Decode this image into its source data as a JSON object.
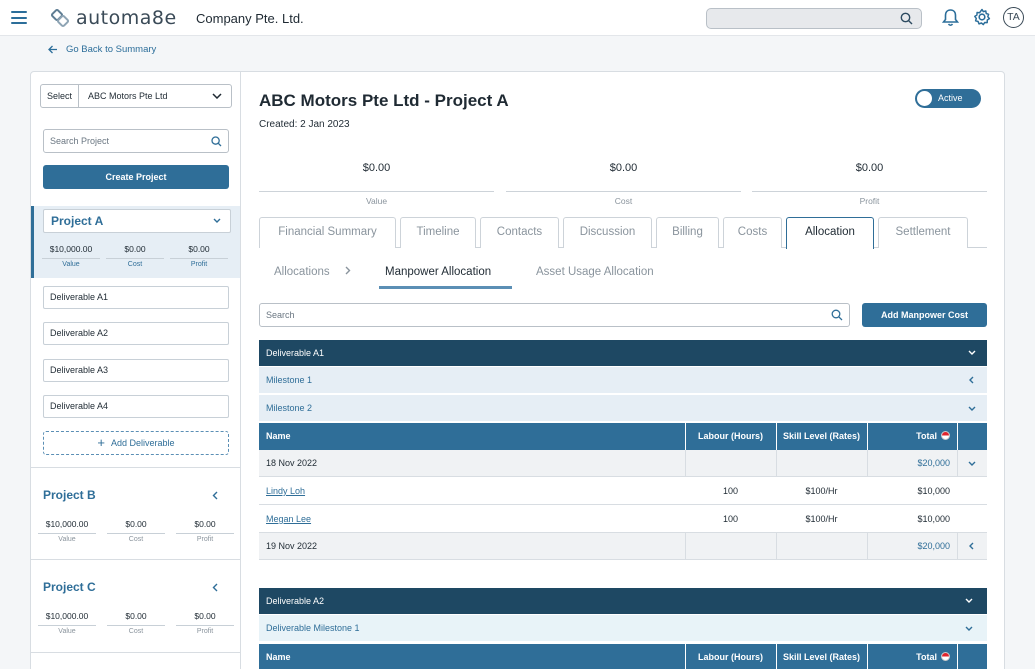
{
  "header": {
    "brand": "automa8e",
    "company": "Company Pte. Ltd.",
    "avatar_initials": "TA",
    "search_placeholder": ""
  },
  "back_link": "Go Back to Summary",
  "sidebar": {
    "select_label": "Select",
    "selected_client": "ABC Motors Pte Ltd",
    "search_placeholder": "Search Project",
    "create_label": "Create Project",
    "add_deliverable_label": "Add Deliverable",
    "projects": [
      {
        "name": "Project A",
        "value": "$10,000.00",
        "cost": "$0.00",
        "profit": "$0.00"
      },
      {
        "name": "Project B",
        "value": "$10,000.00",
        "cost": "$0.00",
        "profit": "$0.00"
      },
      {
        "name": "Project C",
        "value": "$10,000.00",
        "cost": "$0.00",
        "profit": "$0.00"
      }
    ],
    "stat_labels": {
      "value": "Value",
      "cost": "Cost",
      "profit": "Profit"
    },
    "deliverables": [
      "Deliverable A1",
      "Deliverable A2",
      "Deliverable A3",
      "Deliverable A4"
    ]
  },
  "main": {
    "title": "ABC Motors Pte Ltd - Project A",
    "created": "Created: 2 Jan 2023",
    "status": "Active",
    "summary": [
      {
        "amount": "$0.00",
        "label": "Value"
      },
      {
        "amount": "$0.00",
        "label": "Cost"
      },
      {
        "amount": "$0.00",
        "label": "Profit"
      }
    ],
    "tabs": [
      "Financial Summary",
      "Timeline",
      "Contacts",
      "Discussion",
      "Billing",
      "Costs",
      "Allocation",
      "Settlement"
    ],
    "active_tab": "Allocation",
    "subtabs": [
      "Allocations",
      "Manpower Allocation",
      "Asset Usage Allocation"
    ],
    "search_placeholder": "Search",
    "add_cost_label": "Add Manpower Cost"
  },
  "table": {
    "columns": [
      "Name",
      "Labour (Hours)",
      "Skill Level (Rates)",
      "Total"
    ],
    "sections": [
      {
        "deliverable": "Deliverable A1",
        "milestones": [
          "Milestone 1",
          "Milestone 2"
        ],
        "groups": [
          {
            "date": "18 Nov 2022",
            "total": "$20,000",
            "rows": [
              {
                "name": "Lindy Loh",
                "hours": "100",
                "rate": "$100/Hr",
                "total": "$10,000"
              },
              {
                "name": "Megan Lee",
                "hours": "100",
                "rate": "$100/Hr",
                "total": "$10,000"
              }
            ]
          },
          {
            "date": "19 Nov 2022",
            "total": "$20,000",
            "rows": []
          }
        ]
      },
      {
        "deliverable": "Deliverable A2",
        "milestones": [
          "Deliverable Milestone 1"
        ]
      }
    ]
  },
  "colors": {
    "primary": "#2f6e98",
    "dark": "#1e4863",
    "light": "#e6eef5"
  }
}
